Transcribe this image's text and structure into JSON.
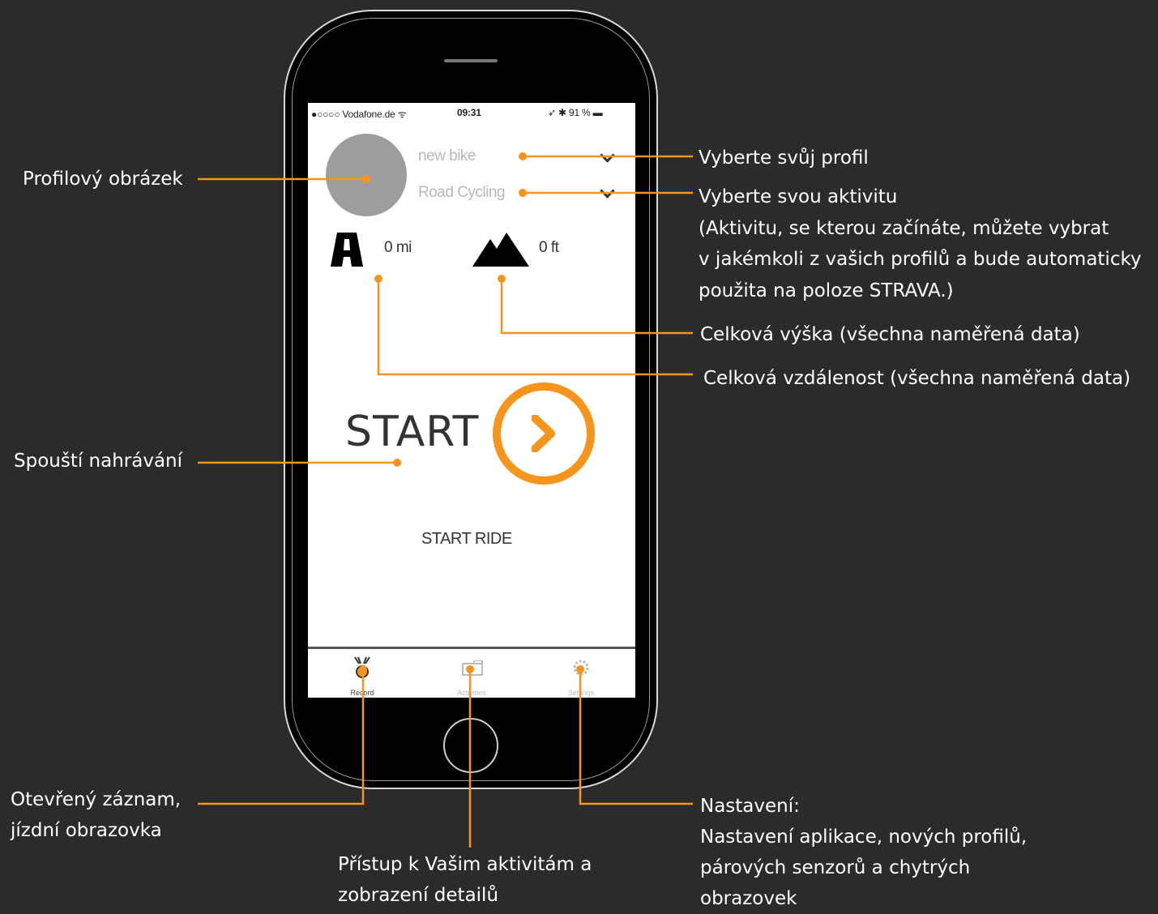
{
  "phone": {
    "status_bar": {
      "carrier": "●○○○○ Vodafone.de ᯤ",
      "time": "09:31",
      "battery": "➶ ✱ 91 % ▬"
    },
    "profile_selector": {
      "label": "new bike",
      "icon": "chevron-down-icon"
    },
    "activity_selector": {
      "label": "Road Cycling",
      "icon": "chevron-down-icon"
    },
    "stats": {
      "distance": {
        "value": "0 mi",
        "icon": "road-icon"
      },
      "elevation": {
        "value": "0 ft",
        "icon": "mountain-icon"
      }
    },
    "start_label": "START",
    "start_ride_label": "START RIDE",
    "tabs": [
      {
        "label": "Record",
        "icon": "bike-icon"
      },
      {
        "label": "Activities",
        "icon": "folder-icon"
      },
      {
        "label": "Settings",
        "icon": "gear-icon"
      }
    ]
  },
  "callouts": {
    "profile_picture": "Profilový obrázek",
    "select_profile": "Vyberte svůj profil",
    "select_activity": {
      "title": "Vyberte svou aktivitu",
      "line1": "(Aktivitu, se kterou začínáte, můžete vybrat",
      "line2": "v jakémkoli z vašich profilů a bude automaticky",
      "line3": "použita na poloze STRAVA.)"
    },
    "total_elevation": "Celková výška (všechna naměřená data)",
    "total_distance": "Celková vzdálenost (všechna naměřená data)",
    "start_recording": "Spouští nahrávání",
    "open_record": {
      "line1": "Otevřený záznam,",
      "line2": "jízdní obrazovka"
    },
    "activities_access": {
      "line1": "Přístup k Vašim aktivitám a",
      "line2": "zobrazení detailů"
    },
    "settings": {
      "title": "Nastavení:",
      "line1": "Nastavení aplikace, nových profilů,",
      "line2": "párových senzorů a chytrých",
      "line3": "obrazovek"
    }
  },
  "colors": {
    "background": "#2b2b2b",
    "accent": "#f7941d",
    "callout_text": "#ffffff",
    "avatar": "#9d9d9d"
  }
}
